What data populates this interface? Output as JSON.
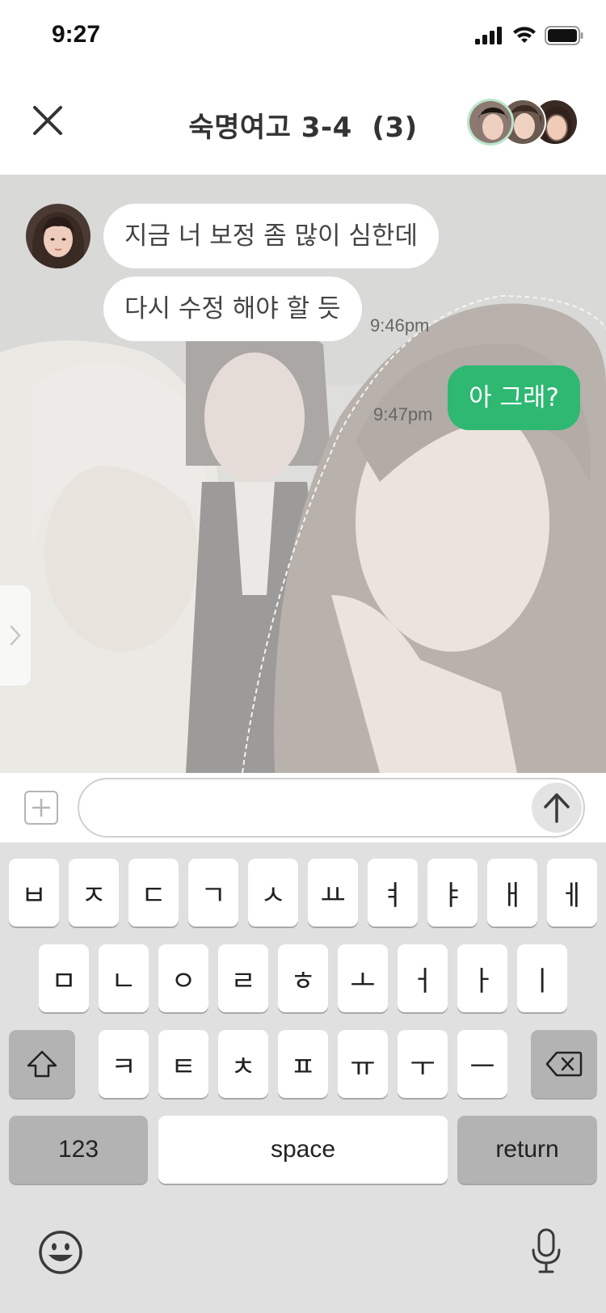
{
  "status": {
    "time": "9:27"
  },
  "header": {
    "title": "숙명여고 3-4  (3)"
  },
  "messages": [
    {
      "text": "지금 너 보정 좀 많이 심한데",
      "direction": "in"
    },
    {
      "text": "다시 수정 해야 할 듯",
      "direction": "in",
      "time": "9:46pm"
    },
    {
      "text": "아 그래?",
      "direction": "out",
      "time": "9:47pm"
    }
  ],
  "colors": {
    "accent": "#2eb872",
    "keyboard_bg": "#e0e0e0",
    "dark_key": "#b3b3b3"
  },
  "input": {
    "placeholder": ""
  },
  "keyboard": {
    "row1": [
      "ㅂ",
      "ㅈ",
      "ㄷ",
      "ㄱ",
      "ㅅ",
      "ㅛ",
      "ㅕ",
      "ㅑ",
      "ㅐ",
      "ㅔ"
    ],
    "row2": [
      "ㅁ",
      "ㄴ",
      "ㅇ",
      "ㄹ",
      "ㅎ",
      "ㅗ",
      "ㅓ",
      "ㅏ",
      "ㅣ"
    ],
    "row3": [
      "ㅋ",
      "ㅌ",
      "ㅊ",
      "ㅍ",
      "ㅠ",
      "ㅜ",
      "ㅡ"
    ],
    "numbers_label": "123",
    "space_label": "space",
    "return_label": "return"
  },
  "icons": {
    "close": "close-icon",
    "send": "arrow-up-icon",
    "add": "plus-icon",
    "shift": "shift-icon",
    "delete": "backspace-icon",
    "emoji": "emoji-icon",
    "mic": "microphone-icon",
    "side": "chevron-right-icon"
  }
}
